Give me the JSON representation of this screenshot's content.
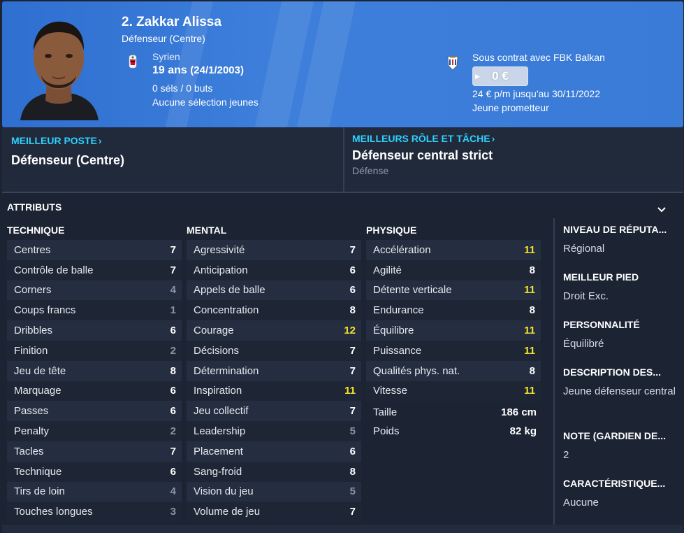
{
  "header": {
    "name": "2. Zakkar Alissa",
    "position": "Défenseur (Centre)",
    "nationality": "Syrien",
    "age": "19 ans",
    "dob": "(24/1/2003)",
    "caps": "0 séls / 0 buts",
    "youth_caps": "Aucune sélection jeunes",
    "contract": "Sous contrat avec FBK Balkan",
    "value": "0 €",
    "wage": "24 € p/m jusqu'au 30/11/2022",
    "status": "Jeune prometteur",
    "colors": {
      "header_bg": "#3a7bd7",
      "accent": "#2fd0ff",
      "highlight": "#f3e32a"
    }
  },
  "best_position": {
    "title": "MEILLEUR POSTE",
    "value": "Défenseur (Centre)"
  },
  "best_role": {
    "title": "MEILLEURS RÔLE ET TÂCHE",
    "value": "Défenseur central strict",
    "sub": "Défense"
  },
  "attributes": {
    "title": "ATTRIBUTS",
    "technique": {
      "label": "TECHNIQUE",
      "rows": [
        {
          "name": "Centres",
          "value": "7"
        },
        {
          "name": "Contrôle de balle",
          "value": "7"
        },
        {
          "name": "Corners",
          "value": "4"
        },
        {
          "name": "Coups francs",
          "value": "1"
        },
        {
          "name": "Dribbles",
          "value": "6"
        },
        {
          "name": "Finition",
          "value": "2"
        },
        {
          "name": "Jeu de tête",
          "value": "8"
        },
        {
          "name": "Marquage",
          "value": "6"
        },
        {
          "name": "Passes",
          "value": "6"
        },
        {
          "name": "Penalty",
          "value": "2"
        },
        {
          "name": "Tacles",
          "value": "7"
        },
        {
          "name": "Technique",
          "value": "6"
        },
        {
          "name": "Tirs de loin",
          "value": "4"
        },
        {
          "name": "Touches longues",
          "value": "3"
        }
      ]
    },
    "mental": {
      "label": "MENTAL",
      "rows": [
        {
          "name": "Agressivité",
          "value": "7"
        },
        {
          "name": "Anticipation",
          "value": "6"
        },
        {
          "name": "Appels de balle",
          "value": "6"
        },
        {
          "name": "Concentration",
          "value": "8"
        },
        {
          "name": "Courage",
          "value": "12"
        },
        {
          "name": "Décisions",
          "value": "7"
        },
        {
          "name": "Détermination",
          "value": "7"
        },
        {
          "name": "Inspiration",
          "value": "11"
        },
        {
          "name": "Jeu collectif",
          "value": "7"
        },
        {
          "name": "Leadership",
          "value": "5"
        },
        {
          "name": "Placement",
          "value": "6"
        },
        {
          "name": "Sang-froid",
          "value": "8"
        },
        {
          "name": "Vision du jeu",
          "value": "5"
        },
        {
          "name": "Volume de jeu",
          "value": "7"
        }
      ]
    },
    "physique": {
      "label": "PHYSIQUE",
      "rows": [
        {
          "name": "Accélération",
          "value": "11"
        },
        {
          "name": "Agilité",
          "value": "8"
        },
        {
          "name": "Détente verticale",
          "value": "11"
        },
        {
          "name": "Endurance",
          "value": "8"
        },
        {
          "name": "Équilibre",
          "value": "11"
        },
        {
          "name": "Puissance",
          "value": "11"
        },
        {
          "name": "Qualités phys. nat.",
          "value": "8"
        },
        {
          "name": "Vitesse",
          "value": "11"
        }
      ],
      "height_label": "Taille",
      "height": "186 cm",
      "weight_label": "Poids",
      "weight": "82 kg"
    }
  },
  "side_info": [
    {
      "title": "NIVEAU DE RÉPUTA...",
      "value": "Régional"
    },
    {
      "title": "MEILLEUR PIED",
      "value": "Droit Exc."
    },
    {
      "title": "PERSONNALITÉ",
      "value": "Équilibré"
    },
    {
      "title": "DESCRIPTION DES...",
      "value": "Jeune défenseur central"
    },
    {
      "title": "NOTE (GARDIEN DE...",
      "value": "2"
    },
    {
      "title": "CARACTÉRISTIQUE...",
      "value": "Aucune"
    }
  ]
}
